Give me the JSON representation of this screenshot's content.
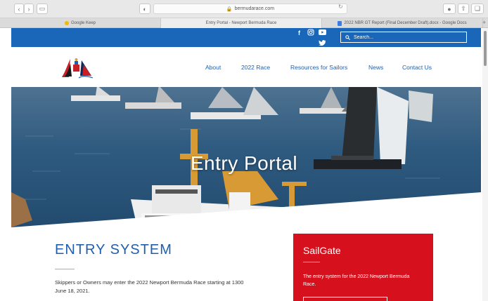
{
  "browser": {
    "url": "bermudarace.com",
    "tabs": [
      {
        "title": "Google Keep"
      },
      {
        "title": "Entry Portal - Newport Bermuda Race"
      },
      {
        "title": "2022 NBR GT Report (Final December Draft).docx - Google Docs"
      }
    ]
  },
  "site": {
    "search_placeholder": "Search...",
    "social": [
      "facebook-icon",
      "instagram-icon",
      "youtube-icon",
      "twitter-icon"
    ],
    "nav": [
      "About",
      "2022 Race",
      "Resources for Sailors",
      "News",
      "Contact Us"
    ],
    "hero_title": "Entry Portal",
    "colors": {
      "brand_blue": "#1a66b8",
      "nav_blue": "#1f5fae",
      "sailgate_red": "#d6101c"
    }
  },
  "entry": {
    "title": "ENTRY SYSTEM",
    "body": "Skippers or Owners may enter the 2022 Newport Bermuda Race starting at 1300 June 18, 2021."
  },
  "sailgate": {
    "title": "SailGate",
    "body": "The entry system for the 2022 Newport Bermuda Race."
  }
}
